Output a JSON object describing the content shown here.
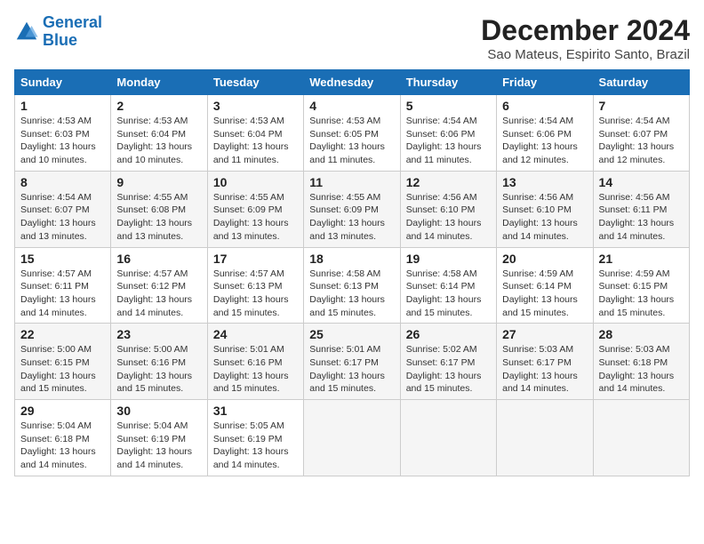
{
  "logo": {
    "line1": "General",
    "line2": "Blue"
  },
  "title": "December 2024",
  "subtitle": "Sao Mateus, Espirito Santo, Brazil",
  "days_of_week": [
    "Sunday",
    "Monday",
    "Tuesday",
    "Wednesday",
    "Thursday",
    "Friday",
    "Saturday"
  ],
  "weeks": [
    [
      {
        "day": "1",
        "sunrise": "4:53 AM",
        "sunset": "6:03 PM",
        "daylight": "13 hours and 10 minutes."
      },
      {
        "day": "2",
        "sunrise": "4:53 AM",
        "sunset": "6:04 PM",
        "daylight": "13 hours and 10 minutes."
      },
      {
        "day": "3",
        "sunrise": "4:53 AM",
        "sunset": "6:04 PM",
        "daylight": "13 hours and 11 minutes."
      },
      {
        "day": "4",
        "sunrise": "4:53 AM",
        "sunset": "6:05 PM",
        "daylight": "13 hours and 11 minutes."
      },
      {
        "day": "5",
        "sunrise": "4:54 AM",
        "sunset": "6:06 PM",
        "daylight": "13 hours and 11 minutes."
      },
      {
        "day": "6",
        "sunrise": "4:54 AM",
        "sunset": "6:06 PM",
        "daylight": "13 hours and 12 minutes."
      },
      {
        "day": "7",
        "sunrise": "4:54 AM",
        "sunset": "6:07 PM",
        "daylight": "13 hours and 12 minutes."
      }
    ],
    [
      {
        "day": "8",
        "sunrise": "4:54 AM",
        "sunset": "6:07 PM",
        "daylight": "13 hours and 13 minutes."
      },
      {
        "day": "9",
        "sunrise": "4:55 AM",
        "sunset": "6:08 PM",
        "daylight": "13 hours and 13 minutes."
      },
      {
        "day": "10",
        "sunrise": "4:55 AM",
        "sunset": "6:09 PM",
        "daylight": "13 hours and 13 minutes."
      },
      {
        "day": "11",
        "sunrise": "4:55 AM",
        "sunset": "6:09 PM",
        "daylight": "13 hours and 13 minutes."
      },
      {
        "day": "12",
        "sunrise": "4:56 AM",
        "sunset": "6:10 PM",
        "daylight": "13 hours and 14 minutes."
      },
      {
        "day": "13",
        "sunrise": "4:56 AM",
        "sunset": "6:10 PM",
        "daylight": "13 hours and 14 minutes."
      },
      {
        "day": "14",
        "sunrise": "4:56 AM",
        "sunset": "6:11 PM",
        "daylight": "13 hours and 14 minutes."
      }
    ],
    [
      {
        "day": "15",
        "sunrise": "4:57 AM",
        "sunset": "6:11 PM",
        "daylight": "13 hours and 14 minutes."
      },
      {
        "day": "16",
        "sunrise": "4:57 AM",
        "sunset": "6:12 PM",
        "daylight": "13 hours and 14 minutes."
      },
      {
        "day": "17",
        "sunrise": "4:57 AM",
        "sunset": "6:13 PM",
        "daylight": "13 hours and 15 minutes."
      },
      {
        "day": "18",
        "sunrise": "4:58 AM",
        "sunset": "6:13 PM",
        "daylight": "13 hours and 15 minutes."
      },
      {
        "day": "19",
        "sunrise": "4:58 AM",
        "sunset": "6:14 PM",
        "daylight": "13 hours and 15 minutes."
      },
      {
        "day": "20",
        "sunrise": "4:59 AM",
        "sunset": "6:14 PM",
        "daylight": "13 hours and 15 minutes."
      },
      {
        "day": "21",
        "sunrise": "4:59 AM",
        "sunset": "6:15 PM",
        "daylight": "13 hours and 15 minutes."
      }
    ],
    [
      {
        "day": "22",
        "sunrise": "5:00 AM",
        "sunset": "6:15 PM",
        "daylight": "13 hours and 15 minutes."
      },
      {
        "day": "23",
        "sunrise": "5:00 AM",
        "sunset": "6:16 PM",
        "daylight": "13 hours and 15 minutes."
      },
      {
        "day": "24",
        "sunrise": "5:01 AM",
        "sunset": "6:16 PM",
        "daylight": "13 hours and 15 minutes."
      },
      {
        "day": "25",
        "sunrise": "5:01 AM",
        "sunset": "6:17 PM",
        "daylight": "13 hours and 15 minutes."
      },
      {
        "day": "26",
        "sunrise": "5:02 AM",
        "sunset": "6:17 PM",
        "daylight": "13 hours and 15 minutes."
      },
      {
        "day": "27",
        "sunrise": "5:03 AM",
        "sunset": "6:17 PM",
        "daylight": "13 hours and 14 minutes."
      },
      {
        "day": "28",
        "sunrise": "5:03 AM",
        "sunset": "6:18 PM",
        "daylight": "13 hours and 14 minutes."
      }
    ],
    [
      {
        "day": "29",
        "sunrise": "5:04 AM",
        "sunset": "6:18 PM",
        "daylight": "13 hours and 14 minutes."
      },
      {
        "day": "30",
        "sunrise": "5:04 AM",
        "sunset": "6:19 PM",
        "daylight": "13 hours and 14 minutes."
      },
      {
        "day": "31",
        "sunrise": "5:05 AM",
        "sunset": "6:19 PM",
        "daylight": "13 hours and 14 minutes."
      },
      null,
      null,
      null,
      null
    ]
  ]
}
